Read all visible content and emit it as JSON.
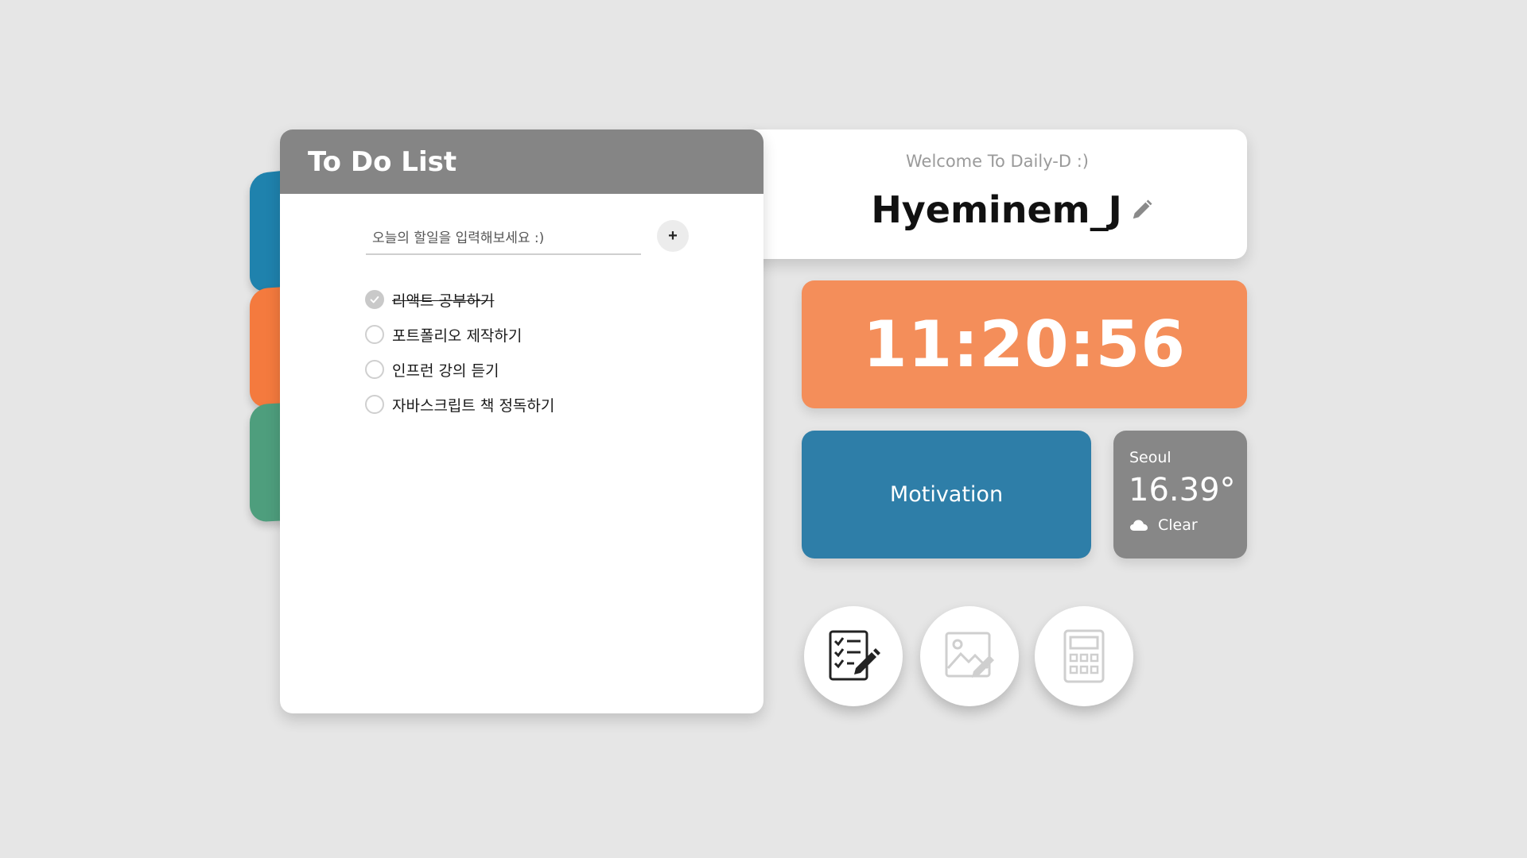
{
  "todo": {
    "title": "To Do List",
    "input_placeholder": "오늘의 할일을 입력해보세요 :)",
    "input_value": "",
    "add_label": "+",
    "items": [
      {
        "label": "리액트 공부하기",
        "done": true
      },
      {
        "label": "포트폴리오 제작하기",
        "done": false
      },
      {
        "label": "인프런 강의 듣기",
        "done": false
      },
      {
        "label": "자바스크립트 책 정독하기",
        "done": false
      }
    ]
  },
  "welcome": {
    "subtitle": "Welcome To Daily-D :)",
    "username": "Hyeminem_J"
  },
  "clock": {
    "time": "11:20:56"
  },
  "motivation": {
    "label": "Motivation"
  },
  "weather": {
    "city": "Seoul",
    "temperature": "16.39°",
    "condition": "Clear",
    "icon": "cloud-icon"
  },
  "side_tabs": [
    {
      "color": "#1f82ad"
    },
    {
      "color": "#f47a3e"
    },
    {
      "color": "#4e9e7d"
    }
  ],
  "apps": [
    {
      "icon": "checklist-edit-icon"
    },
    {
      "icon": "image-edit-icon"
    },
    {
      "icon": "calculator-icon"
    }
  ],
  "colors": {
    "background": "#e6e6e6",
    "todo_header": "#858585",
    "clock": "#f48e5a",
    "motivation": "#2e7ea8",
    "weather": "#878787"
  }
}
